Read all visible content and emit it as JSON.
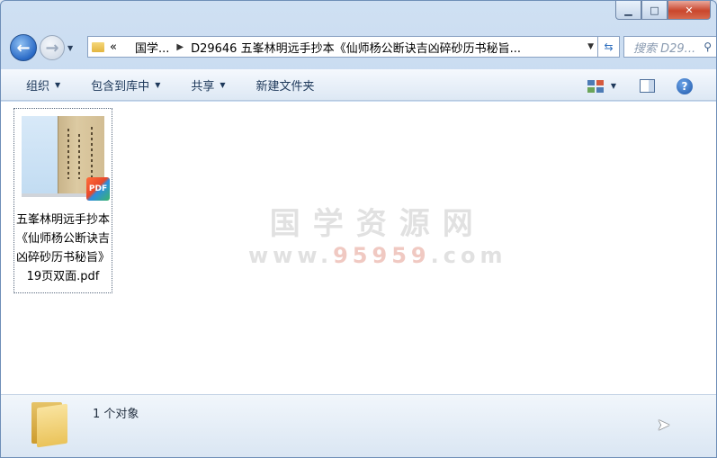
{
  "window": {
    "minimize_label": "▁",
    "maximize_label": "□",
    "close_label": "✕"
  },
  "nav": {
    "back_icon": "back-arrow-icon",
    "forward_icon": "forward-arrow-icon",
    "address": {
      "overflow": "«",
      "crumbs": [
        "国学...",
        "D29646 五峯林明远手抄本《仙师杨公断诀吉凶碎砂历书秘旨..."
      ]
    },
    "search_placeholder": "搜索 D29..."
  },
  "toolbar": {
    "organize": "组织",
    "include_library": "包含到库中",
    "share": "共享",
    "new_folder": "新建文件夹"
  },
  "files": [
    {
      "name": "五峯林明远手抄本《仙师杨公断诀吉凶碎砂历书秘旨》19页双面.pdf",
      "badge": "PDF"
    }
  ],
  "watermark": {
    "line1": "国学资源网",
    "line2_prefix": "www.",
    "line2_num": "95959",
    "line2_suffix": ".com"
  },
  "status": {
    "count_text": "1 个对象"
  }
}
